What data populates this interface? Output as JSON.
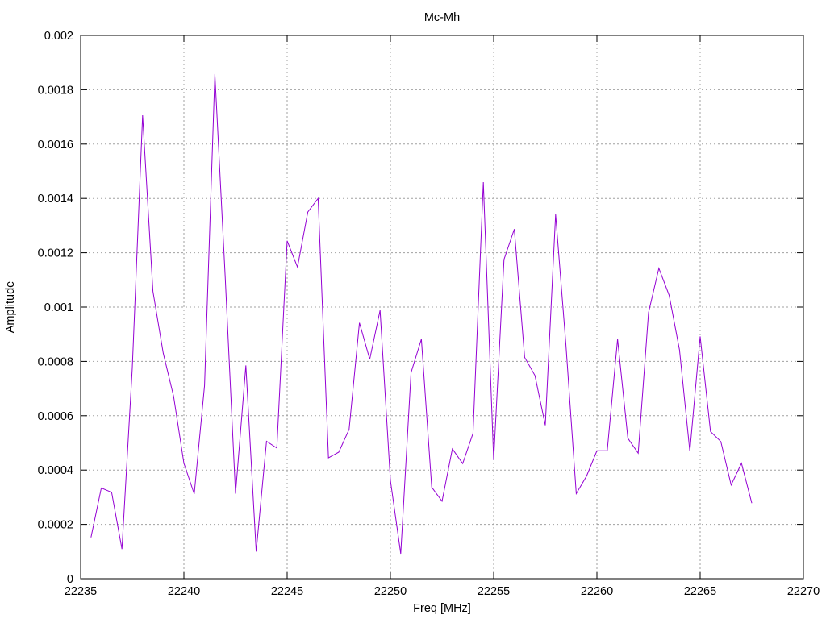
{
  "chart_data": {
    "type": "line",
    "title": "Mc-Mh",
    "xlabel": "Freq [MHz]",
    "ylabel": "Amplitude",
    "xlim": [
      22235,
      22270
    ],
    "ylim": [
      0,
      0.002
    ],
    "grid": true,
    "x_ticks": [
      22235,
      22240,
      22245,
      22250,
      22255,
      22260,
      22265,
      22270
    ],
    "x_tick_labels": [
      "22235",
      "22240",
      "22245",
      "22250",
      "22255",
      "22260",
      "22265",
      "22270"
    ],
    "y_ticks": [
      0,
      0.0002,
      0.0004,
      0.0006,
      0.0008,
      0.001,
      0.0012,
      0.0014,
      0.0016,
      0.0018,
      0.002
    ],
    "y_tick_labels": [
      "0",
      "0.0002",
      "0.0004",
      "0.0006",
      "0.0008",
      "0.001",
      "0.0012",
      "0.0014",
      "0.0016",
      "0.0018",
      "0.002"
    ],
    "series": [
      {
        "color": "#9400d3",
        "x": [
          22235.5,
          22236.0,
          22236.5,
          22237.0,
          22237.5,
          22238.0,
          22238.5,
          22239.0,
          22239.5,
          22240.0,
          22240.5,
          22241.0,
          22241.5,
          22242.0,
          22242.5,
          22243.0,
          22243.5,
          22244.0,
          22244.5,
          22245.0,
          22245.5,
          22246.0,
          22246.5,
          22247.0,
          22247.5,
          22248.0,
          22248.5,
          22249.0,
          22249.5,
          22250.0,
          22250.5,
          22251.0,
          22251.5,
          22252.0,
          22252.5,
          22253.0,
          22253.5,
          22254.0,
          22254.5,
          22255.0,
          22255.5,
          22256.0,
          22256.5,
          22257.0,
          22257.5,
          22258.0,
          22258.5,
          22259.0,
          22259.5,
          22260.0,
          22260.5,
          22261.0,
          22261.5,
          22262.0,
          22262.5,
          22263.0,
          22263.5,
          22264.0,
          22264.5,
          22265.0,
          22265.5,
          22266.0,
          22266.5,
          22267.0,
          22267.5
        ],
        "y": [
          0.000152,
          0.000334,
          0.000318,
          0.000109,
          0.000775,
          0.001706,
          0.001058,
          0.00083,
          0.000672,
          0.000425,
          0.000312,
          0.000712,
          0.001858,
          0.001111,
          0.000313,
          0.000785,
          0.0001,
          0.000506,
          0.000481,
          0.001244,
          0.001147,
          0.00135,
          0.0014,
          0.000445,
          0.000466,
          0.00055,
          0.000942,
          0.000808,
          0.000988,
          0.000362,
          9.2e-05,
          0.000759,
          0.000882,
          0.000337,
          0.000285,
          0.000478,
          0.000424,
          0.000535,
          0.00146,
          0.000437,
          0.001175,
          0.001287,
          0.000815,
          0.000748,
          0.000565,
          0.001341,
          0.00086,
          0.000313,
          0.000378,
          0.000471,
          0.000471,
          0.000882,
          0.000517,
          0.000462,
          0.00098,
          0.001143,
          0.001043,
          0.000842,
          0.000469,
          0.000892,
          0.000542,
          0.000505,
          0.000345,
          0.000425,
          0.000278
        ]
      }
    ]
  }
}
